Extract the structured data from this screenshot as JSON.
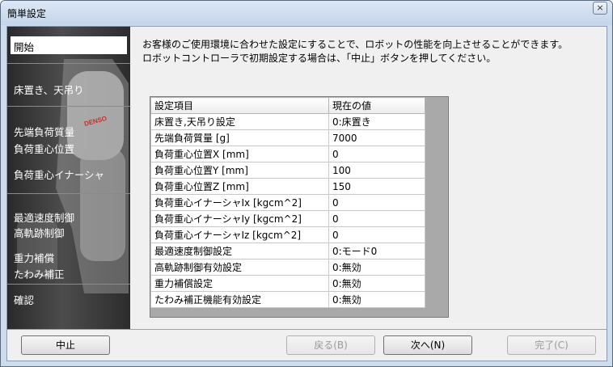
{
  "window": {
    "title": "簡単設定",
    "close_glyph": "×"
  },
  "sidebar": {
    "items": [
      {
        "label": "開始",
        "active": true
      },
      {
        "label": "床置き、天吊り"
      },
      {
        "label": "先端負荷質量"
      },
      {
        "label": "負荷重心位置"
      },
      {
        "label": "負荷重心イナーシャ"
      },
      {
        "label": "最適速度制御"
      },
      {
        "label": "高軌跡制御"
      },
      {
        "label": "重力補償"
      },
      {
        "label": "たわみ補正"
      },
      {
        "label": "確認"
      }
    ],
    "robot_brand": "DENSO"
  },
  "main": {
    "description_line1": "お客様のご使用環境に合わせた設定にすることで、ロボットの性能を向上させることができます。",
    "description_line2": "ロボットコントローラで初期設定する場合は、「中止」ボタンを押してください。"
  },
  "table": {
    "headers": {
      "item": "設定項目",
      "value": "現在の値"
    },
    "rows": [
      {
        "item": "床置き,天吊り設定",
        "value": "0:床置き"
      },
      {
        "item": "先端負荷質量 [g]",
        "value": "7000"
      },
      {
        "item": "負荷重心位置X [mm]",
        "value": "0"
      },
      {
        "item": "負荷重心位置Y [mm]",
        "value": "100"
      },
      {
        "item": "負荷重心位置Z [mm]",
        "value": "150"
      },
      {
        "item": "負荷重心イナーシャIx [kgcm^2]",
        "value": "0"
      },
      {
        "item": "負荷重心イナーシャIy [kgcm^2]",
        "value": "0"
      },
      {
        "item": "負荷重心イナーシャIz [kgcm^2]",
        "value": "0"
      },
      {
        "item": "最適速度制御設定",
        "value": "0:モード0"
      },
      {
        "item": "高軌跡制御有効設定",
        "value": "0:無効"
      },
      {
        "item": "重力補償設定",
        "value": "0:無効"
      },
      {
        "item": "たわみ補正機能有効設定",
        "value": "0:無効"
      }
    ]
  },
  "buttons": {
    "cancel": "中止",
    "back": "戻る(B)",
    "next": "次へ(N)",
    "finish": "完了(C)"
  }
}
